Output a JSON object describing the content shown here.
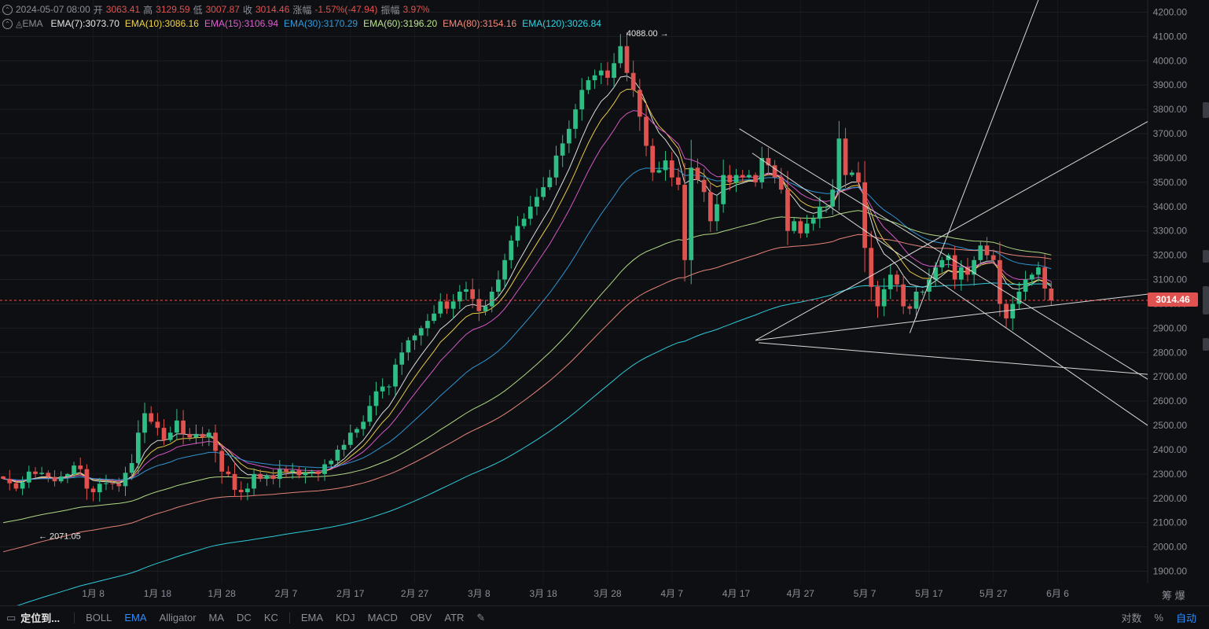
{
  "header": {
    "date": "2024-05-07 08:00",
    "open_label": "开",
    "open": "3063.41",
    "high_label": "高",
    "high": "3129.59",
    "low_label": "低",
    "low": "3007.87",
    "close_label": "收",
    "close": "3014.46",
    "change_label": "涨幅",
    "change": "-1.57%(-47.94)",
    "amp_label": "振幅",
    "amp": "3.97%"
  },
  "indicator": {
    "name": "EMA",
    "items": [
      {
        "label": "EMA(7):3073.70",
        "color": "#e6e6e6"
      },
      {
        "label": "EMA(10):3086.16",
        "color": "#f2d44a"
      },
      {
        "label": "EMA(15):3106.94",
        "color": "#e05bd0"
      },
      {
        "label": "EMA(30):3170.29",
        "color": "#2f9bdc"
      },
      {
        "label": "EMA(60):3196.20",
        "color": "#b9e38b"
      },
      {
        "label": "EMA(80):3154.16",
        "color": "#f08a7e"
      },
      {
        "label": "EMA(120):3026.84",
        "color": "#2fd6e6"
      }
    ]
  },
  "annotations": {
    "max_label": "4088.00",
    "min_label": "2071.05"
  },
  "current_price": "3014.46",
  "toolbar": {
    "locate": "定位到...",
    "main_indicators": [
      "BOLL",
      "EMA",
      "Alligator",
      "MA",
      "DC",
      "KC"
    ],
    "sub_indicators": [
      "EMA",
      "KDJ",
      "MACD",
      "OBV",
      "ATR"
    ],
    "right": [
      "对数",
      "%",
      "自动"
    ]
  },
  "axis_buttons": "筹 爆",
  "colors": {
    "up": "#2ebd85",
    "down": "#e0524f",
    "bg": "#0e0f12",
    "active": "#2f8cf7"
  },
  "chart_data": {
    "type": "candlestick",
    "title": "",
    "y_ticks": [
      4200,
      4100,
      4000,
      3900,
      3800,
      3700,
      3600,
      3500,
      3400,
      3300,
      3200,
      3100,
      3000,
      2900,
      2800,
      2700,
      2600,
      2500,
      2400,
      2300,
      2200,
      2100,
      2000,
      1900
    ],
    "x_ticks": [
      "1月 8",
      "1月 18",
      "1月 28",
      "2月 7",
      "2月 17",
      "2月 27",
      "3月 8",
      "3月 18",
      "3月 28",
      "4月 7",
      "4月 17",
      "4月 27",
      "5月 7",
      "5月 17",
      "5月 27",
      "6月 6"
    ],
    "x_tick_days": [
      7,
      17,
      27,
      37,
      47,
      57,
      67,
      77,
      87,
      97,
      107,
      117,
      127,
      137,
      147,
      157
    ],
    "ylim": [
      1850,
      4250
    ],
    "xlim_days": [
      -7.5,
      171
    ],
    "candles_start_day": -7,
    "closes": [
      2280,
      2262,
      2240,
      2265,
      2310,
      2300,
      2305,
      2288,
      2270,
      2290,
      2300,
      2335,
      2320,
      2240,
      2225,
      2260,
      2262,
      2260,
      2250,
      2305,
      2345,
      2470,
      2550,
      2515,
      2490,
      2440,
      2470,
      2520,
      2465,
      2450,
      2465,
      2450,
      2470,
      2395,
      2310,
      2300,
      2235,
      2225,
      2240,
      2300,
      2280,
      2295,
      2280,
      2320,
      2310,
      2315,
      2295,
      2305,
      2310,
      2300,
      2340,
      2355,
      2400,
      2420,
      2470,
      2485,
      2515,
      2580,
      2640,
      2660,
      2660,
      2750,
      2800,
      2850,
      2870,
      2900,
      2930,
      2960,
      3010,
      2980,
      3010,
      3050,
      3060,
      3020,
      2970,
      2990,
      3050,
      3100,
      3180,
      3260,
      3320,
      3350,
      3400,
      3440,
      3480,
      3520,
      3610,
      3660,
      3720,
      3800,
      3880,
      3920,
      3940,
      3960,
      3930,
      3990,
      4060,
      3950,
      3880,
      3770,
      3650,
      3540,
      3550,
      3590,
      3520,
      3490,
      3180,
      3560,
      3510,
      3460,
      3340,
      3410,
      3530,
      3500,
      3530,
      3520,
      3530,
      3500,
      3600,
      3570,
      3520,
      3470,
      3300,
      3340,
      3290,
      3330,
      3350,
      3400,
      3400,
      3470,
      3680,
      3530,
      3540,
      3500,
      3230,
      3070,
      2990,
      3060,
      3120,
      3080,
      2990,
      2980,
      3050,
      3050,
      3100,
      3150,
      3180,
      3200,
      3100,
      3150,
      3120,
      3180,
      3240,
      3200,
      3180,
      3000,
      2940,
      3000,
      3050,
      3100,
      3120,
      3150,
      3063,
      3014
    ],
    "annotations": [
      {
        "text": "4088.00",
        "day": 97,
        "value": 4088
      },
      {
        "text": "2071.05",
        "day": -2,
        "value": 2071
      }
    ],
    "last_price": 3014.46,
    "series": [
      {
        "name": "EMA(7)",
        "color": "#e6e6e6",
        "period": 7
      },
      {
        "name": "EMA(10)",
        "color": "#f2d44a",
        "period": 10
      },
      {
        "name": "EMA(15)",
        "color": "#e05bd0",
        "period": 15
      },
      {
        "name": "EMA(30)",
        "color": "#2f9bdc",
        "period": 30
      },
      {
        "name": "EMA(60)",
        "color": "#b9e38b",
        "period": 60
      },
      {
        "name": "EMA(80)",
        "color": "#f08a7e",
        "period": 80
      },
      {
        "name": "EMA(120)",
        "color": "#2fd6e6",
        "period": 120
      }
    ],
    "trendlines": [
      {
        "from": [
          107.5,
          3720
        ],
        "to": [
          171,
          2690
        ]
      },
      {
        "from": [
          109.5,
          3620
        ],
        "to": [
          171,
          2500
        ]
      },
      {
        "from": [
          110,
          2850
        ],
        "to": [
          171,
          3040
        ]
      },
      {
        "from": [
          110.5,
          2840
        ],
        "to": [
          171,
          2710
        ]
      },
      {
        "from": [
          134,
          2880
        ],
        "to": [
          154,
          4250
        ]
      },
      {
        "from": [
          110,
          2850
        ],
        "to": [
          171,
          3750
        ]
      }
    ]
  }
}
